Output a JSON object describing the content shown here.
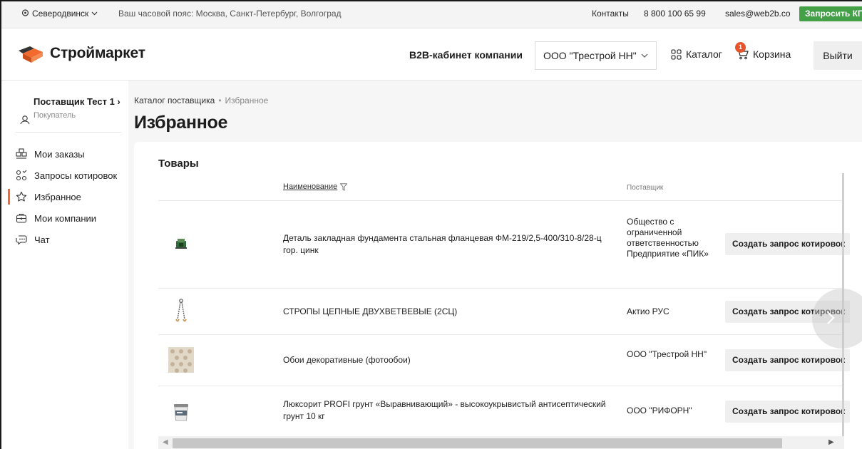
{
  "topbar": {
    "city": "Северодвинск",
    "timezone": "Ваш часовой пояс: Москва, Санкт-Петербург, Волгоград",
    "contacts": "Контакты",
    "phone": "8 800 100 65 99",
    "email": "sales@web2b.co",
    "request_kp": "Запросить КП"
  },
  "header": {
    "logo_text": "Строймаркет",
    "b2b_label": "B2B-кабинет компании",
    "company": "ООО \"Трестрой НН\"",
    "catalog": "Каталог",
    "cart": "Корзина",
    "cart_count": "1",
    "logout": "Выйти"
  },
  "sidebar": {
    "user_name": "Поставщик Тест 1",
    "user_role": "Покупатель",
    "items": [
      {
        "label": "Мои заказы",
        "icon": "orders-icon"
      },
      {
        "label": "Запросы котировок",
        "icon": "quotes-icon"
      },
      {
        "label": "Избранное",
        "icon": "star-icon",
        "active": true
      },
      {
        "label": "Мои компании",
        "icon": "company-icon"
      },
      {
        "label": "Чат",
        "icon": "chat-icon"
      }
    ]
  },
  "breadcrumb": {
    "parent": "Каталог поставщика",
    "separator": "•",
    "current": "Избранное"
  },
  "page_title": "Избранное",
  "section_title": "Товары",
  "table": {
    "col_name": "Наименование",
    "col_supplier": "Поставщик",
    "rows": [
      {
        "name": "Деталь закладная фундамента стальная фланцевая ФМ-219/2,5-400/310-8/28-ц гор. цинк",
        "supplier": "Общество с ограниченной ответственностью Предприятие «ПИК»",
        "button": "Создать запрос котировок",
        "thumb": "flange-thumb"
      },
      {
        "name": "СТРОПЫ ЦЕПНЫЕ ДВУХВЕТВЕВЫЕ (2СЦ)",
        "supplier": "Актио РУС",
        "button": "Создать запрос котировок",
        "thumb": "chain-sling-thumb"
      },
      {
        "name": "Обои декоративные (фотообои)",
        "supplier": "ООО \"Трестрой НН\"",
        "button": "Создать запрос котировок",
        "thumb": "wallpaper-thumb"
      },
      {
        "name": "Люксорит PROFI грунт «Выравнивающий» - высокоукрывистый антисептический грунт 10 кг",
        "supplier": "ООО \"РИФОРН\"",
        "button": "Создать запрос котировок",
        "thumb": "primer-bucket-thumb"
      }
    ]
  },
  "colors": {
    "accent": "#f26a2e",
    "green": "#43a047",
    "badge": "#e8542a"
  }
}
